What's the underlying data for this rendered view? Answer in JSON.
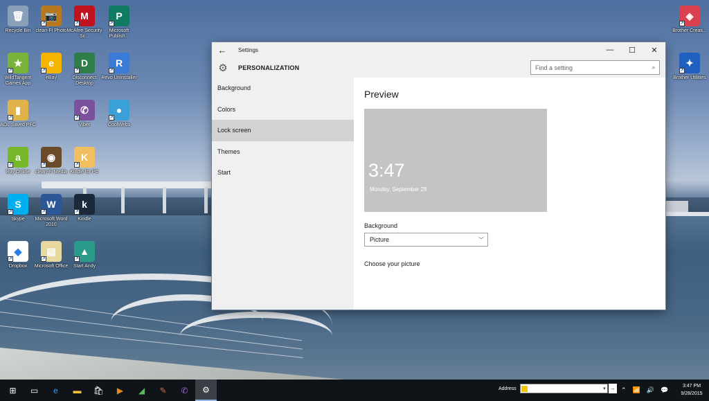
{
  "desktop": {
    "icons": [
      {
        "label": "Recycle Bin",
        "glyph": "🗑",
        "color": "#8aa0b8"
      },
      {
        "label": "clean-Fi Photo",
        "glyph": "📷",
        "color": "#b87820"
      },
      {
        "label": "McAfee Security Sc...",
        "glyph": "M",
        "color": "#c1121f"
      },
      {
        "label": "Microsoft Publish...",
        "glyph": "P",
        "color": "#0f7b63"
      },
      {
        "label": "WildTangent Games App",
        "glyph": "★",
        "color": "#7ab33a"
      },
      {
        "label": "eBay",
        "glyph": "e",
        "color": "#f5b400"
      },
      {
        "label": "Disconnect Desktop",
        "glyph": "D",
        "color": "#2f7d4a"
      },
      {
        "label": "Revo Uninstaller",
        "glyph": "R",
        "color": "#3a7bd5"
      },
      {
        "label": "AOL Saved PFC",
        "glyph": "▮",
        "color": "#e0b34a"
      },
      {
        "label": "Viber",
        "glyph": "✆",
        "color": "#7b519d"
      },
      {
        "label": "CoolWebs",
        "glyph": "●",
        "color": "#3aa0d8"
      },
      {
        "label": "Buy Online",
        "glyph": "a",
        "color": "#76b82a"
      },
      {
        "label": "clean-Fi Media",
        "glyph": "◉",
        "color": "#6b4a2a"
      },
      {
        "label": "Kindle for PC",
        "glyph": "K",
        "color": "#f0c060"
      },
      {
        "label": "Skype",
        "glyph": "S",
        "color": "#00aff0"
      },
      {
        "label": "Microsoft Word 2010",
        "glyph": "W",
        "color": "#2b5797"
      },
      {
        "label": "Kindle",
        "glyph": "k",
        "color": "#1b2a3a"
      },
      {
        "label": "Dropbox",
        "glyph": "◆",
        "color": "#ffffff"
      },
      {
        "label": "Microsoft Office",
        "glyph": "▤",
        "color": "#e8d8a0"
      },
      {
        "label": "Start Andy",
        "glyph": "▲",
        "color": "#2a9a8a"
      },
      {
        "label": "Brother Creati...",
        "glyph": "◈",
        "color": "#d94050"
      },
      {
        "label": "Brother Utilities",
        "glyph": "✦",
        "color": "#1f5fbf"
      }
    ]
  },
  "window": {
    "title": "Settings",
    "back_label": "←",
    "minimize_label": "—",
    "maximize_label": "☐",
    "close_label": "✕",
    "section": "PERSONALIZATION",
    "search_placeholder": "Find a setting",
    "nav": [
      {
        "label": "Background",
        "selected": false
      },
      {
        "label": "Colors",
        "selected": false
      },
      {
        "label": "Lock screen",
        "selected": true
      },
      {
        "label": "Themes",
        "selected": false
      },
      {
        "label": "Start",
        "selected": false
      }
    ],
    "content": {
      "heading": "Preview",
      "preview_time": "3:47",
      "preview_date": "Monday, September 28",
      "background_label": "Background",
      "background_value": "Picture",
      "choose_label": "Choose your picture"
    }
  },
  "taskbar": {
    "address_label": "Address",
    "clock_time": "3:47 PM",
    "clock_date": "9/28/2015"
  }
}
